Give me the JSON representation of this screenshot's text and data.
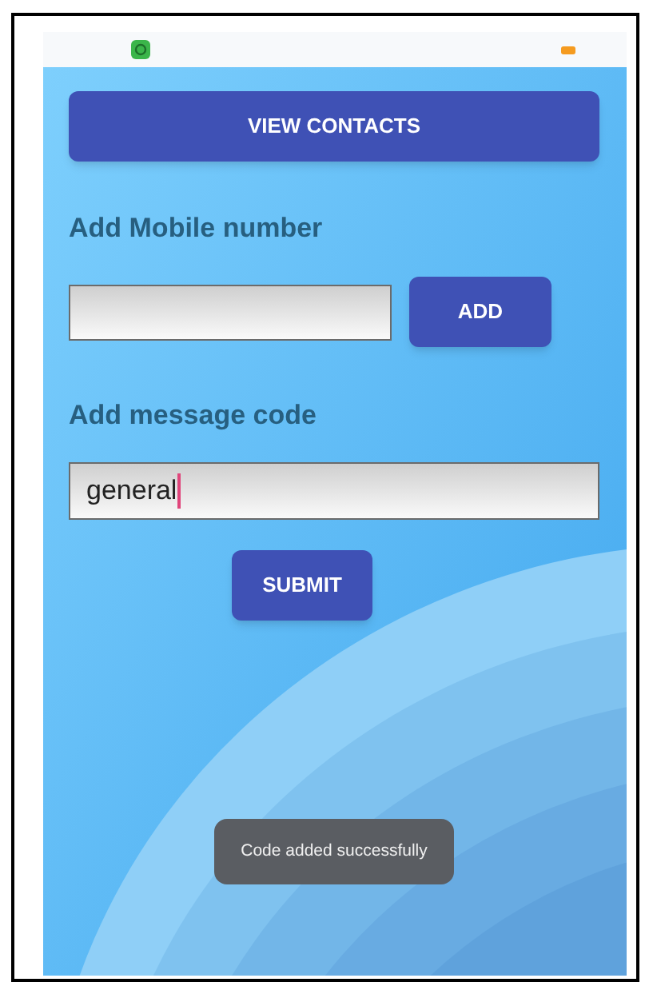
{
  "view_contacts_button": {
    "label": "VIEW CONTACTS"
  },
  "mobile_section": {
    "heading": "Add Mobile number",
    "add_button": {
      "label": "ADD"
    }
  },
  "code_section": {
    "heading": "Add message code",
    "field": {
      "value": "general",
      "focused": true
    },
    "submit_button": {
      "label": "SUBMIT"
    }
  },
  "toast": {
    "message": "Code added successfully"
  }
}
